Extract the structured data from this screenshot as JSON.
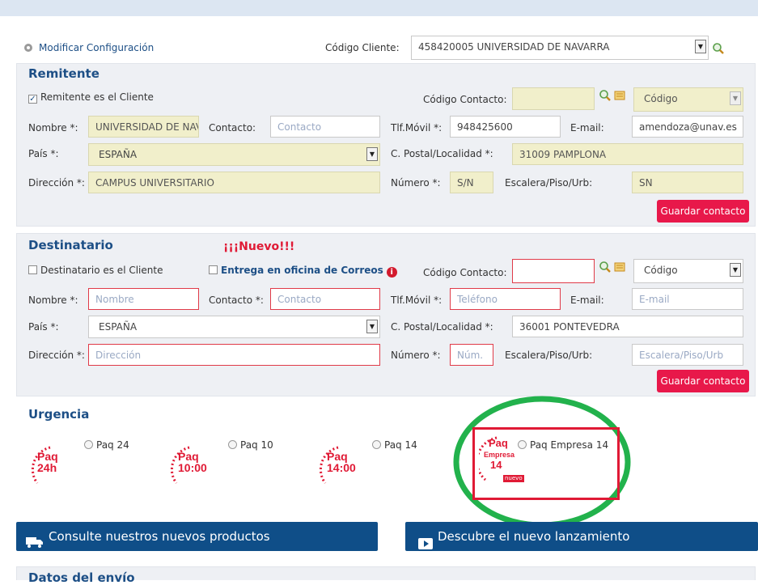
{
  "header": {
    "modify_config": "Modificar Configuración",
    "client_code_label": "Código Cliente:",
    "client_code_value": "458420005 UNIVERSIDAD DE NAVARRA"
  },
  "remitente": {
    "title": "Remitente",
    "same_as_client": "Remitente es el Cliente",
    "contact_code_label": "Código Contacto:",
    "code_select": "Código",
    "name_label": "Nombre *:",
    "name_value": "UNIVERSIDAD DE NAV/",
    "contact_label": "Contacto:",
    "contact_placeholder": "Contacto",
    "mobile_label": "Tlf.Móvil *:",
    "mobile_value": "948425600",
    "email_label": "E-mail:",
    "email_value": "amendoza@unav.es",
    "country_label": "País *:",
    "country_value": "ESPAÑA",
    "postal_label": "C. Postal/Localidad *:",
    "postal_value": "31009 PAMPLONA",
    "address_label": "Dirección *:",
    "address_value": "CAMPUS UNIVERSITARIO",
    "number_label": "Número *:",
    "number_value": "S/N",
    "floor_label": "Escalera/Piso/Urb:",
    "floor_value": "SN",
    "save_button": "Guardar contacto"
  },
  "destinatario": {
    "title": "Destinatario",
    "new_badge": "¡¡¡Nuevo!!!",
    "same_as_client": "Destinatario es el Cliente",
    "post_office": "Entrega en oficina de Correos",
    "contact_code_label": "Código Contacto:",
    "code_select": "Código",
    "name_label": "Nombre *:",
    "name_placeholder": "Nombre",
    "contact_label": "Contacto *:",
    "contact_placeholder": "Contacto",
    "mobile_label": "Tlf.Móvil *:",
    "mobile_placeholder": "Teléfono",
    "email_label": "E-mail:",
    "email_placeholder": "E-mail",
    "country_label": "País *:",
    "country_value": "ESPAÑA",
    "postal_label": "C. Postal/Localidad *:",
    "postal_value": "36001 PONTEVEDRA",
    "address_label": "Dirección *:",
    "address_placeholder": "Dirección",
    "number_label": "Número *:",
    "number_placeholder": "Núm.",
    "floor_label": "Escalera/Piso/Urb:",
    "floor_placeholder": "Escalera/Piso/Urb",
    "save_button": "Guardar contacto"
  },
  "urgencia": {
    "title": "Urgencia",
    "options": [
      {
        "label": "Paq 24",
        "logo_top": "Paq",
        "logo_bottom": "24h"
      },
      {
        "label": "Paq 10",
        "logo_top": "Paq",
        "logo_bottom": "10:00"
      },
      {
        "label": "Paq 14",
        "logo_top": "Paq",
        "logo_bottom": "14:00"
      },
      {
        "label": "Paq Empresa 14",
        "logo_top": "Paq",
        "logo_mid": "Empresa",
        "logo_bottom": "14",
        "logo_tag": "nuevo"
      }
    ]
  },
  "banners": {
    "products": "Consulte nuestros nuevos productos",
    "launch": "Descubre el nuevo lanzamiento"
  },
  "footer": {
    "next_section": "Datos del envío"
  },
  "colors": {
    "accent_red": "#e8184a",
    "brand_blue": "#0f4e88",
    "highlight_green": "#22b24c"
  }
}
